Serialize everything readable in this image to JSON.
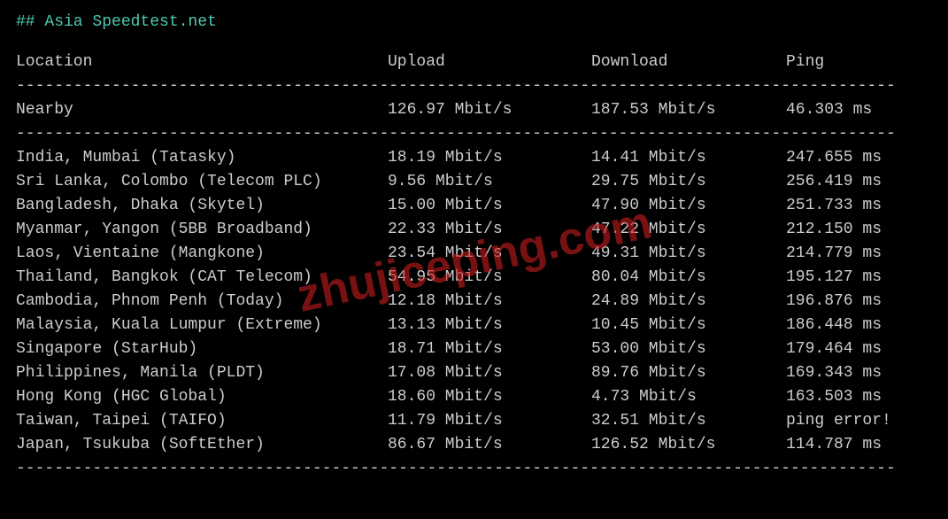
{
  "header": "## Asia Speedtest.net",
  "columns": {
    "location": "Location",
    "upload": "Upload",
    "download": "Download",
    "ping": "Ping"
  },
  "nearby": {
    "location": "Nearby",
    "upload": "126.97 Mbit/s",
    "download": "187.53 Mbit/s",
    "ping": "46.303 ms"
  },
  "rows": [
    {
      "location": "India, Mumbai (Tatasky)",
      "upload": "18.19 Mbit/s",
      "download": "14.41 Mbit/s",
      "ping": "247.655 ms"
    },
    {
      "location": "Sri Lanka, Colombo (Telecom PLC)",
      "upload": "9.56 Mbit/s",
      "download": "29.75 Mbit/s",
      "ping": "256.419 ms"
    },
    {
      "location": "Bangladesh, Dhaka (Skytel)",
      "upload": "15.00 Mbit/s",
      "download": "47.90 Mbit/s",
      "ping": "251.733 ms"
    },
    {
      "location": "Myanmar, Yangon (5BB Broadband)",
      "upload": "22.33 Mbit/s",
      "download": "47.22 Mbit/s",
      "ping": "212.150 ms"
    },
    {
      "location": "Laos, Vientaine (Mangkone)",
      "upload": "23.54 Mbit/s",
      "download": "49.31 Mbit/s",
      "ping": "214.779 ms"
    },
    {
      "location": "Thailand, Bangkok (CAT Telecom)",
      "upload": "54.95 Mbit/s",
      "download": "80.04 Mbit/s",
      "ping": "195.127 ms"
    },
    {
      "location": "Cambodia, Phnom Penh (Today)",
      "upload": "12.18 Mbit/s",
      "download": "24.89 Mbit/s",
      "ping": "196.876 ms"
    },
    {
      "location": "Malaysia, Kuala Lumpur (Extreme)",
      "upload": "13.13 Mbit/s",
      "download": "10.45 Mbit/s",
      "ping": "186.448 ms"
    },
    {
      "location": "Singapore (StarHub)",
      "upload": "18.71 Mbit/s",
      "download": "53.00 Mbit/s",
      "ping": "179.464 ms"
    },
    {
      "location": "Philippines, Manila (PLDT)",
      "upload": "17.08 Mbit/s",
      "download": "89.76 Mbit/s",
      "ping": "169.343 ms"
    },
    {
      "location": "Hong Kong (HGC Global)",
      "upload": "18.60 Mbit/s",
      "download": "4.73 Mbit/s",
      "ping": "163.503 ms"
    },
    {
      "location": "Taiwan, Taipei (TAIFO)",
      "upload": "11.79 Mbit/s",
      "download": "32.51 Mbit/s",
      "ping": "ping error!"
    },
    {
      "location": "Japan, Tsukuba (SoftEther)",
      "upload": "86.67 Mbit/s",
      "download": "126.52 Mbit/s",
      "ping": "114.787 ms"
    }
  ],
  "divider": "--------------------------------------------------------------------------------------------",
  "watermark": "zhujiceping.com"
}
